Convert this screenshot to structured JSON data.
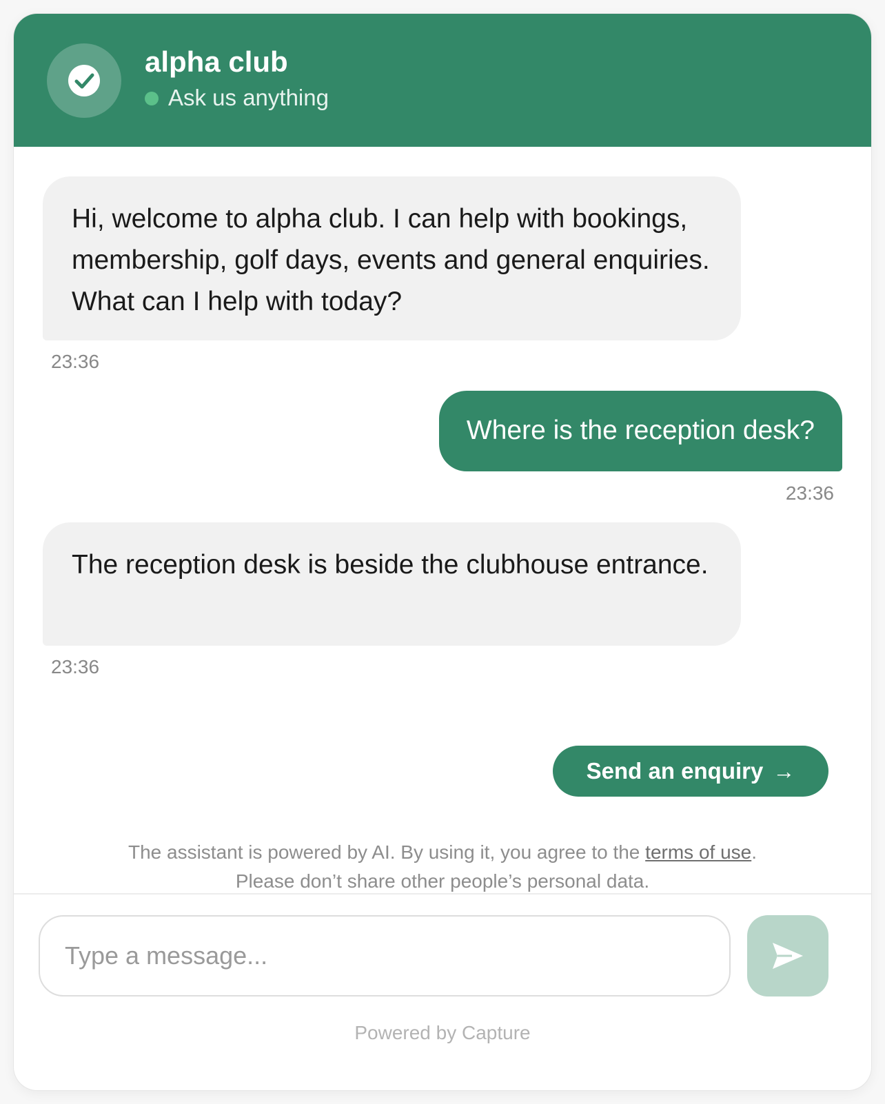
{
  "colors": {
    "brand": "#338868",
    "status_online": "#5cc08a",
    "send_disabled": "#b8d6c9"
  },
  "header": {
    "title": "alpha club",
    "subtitle": "Ask us anything",
    "avatar_icon": "check-icon"
  },
  "messages": [
    {
      "role": "bot",
      "text": "Hi, welcome to alpha club. I can help with bookings, membership, golf days, events and general enquiries. What can I help with today?",
      "time": "23:36"
    },
    {
      "role": "user",
      "text": "Where is the reception desk?",
      "time": "23:36"
    },
    {
      "role": "bot",
      "text": "The reception desk is beside the clubhouse entrance.",
      "time": "23:36"
    }
  ],
  "enquiry_button": {
    "label": "Send an enquiry",
    "arrow": "→"
  },
  "disclaimer": {
    "before_link": "The assistant is powered by AI. By using it, you agree to the ",
    "link_text": "terms of use",
    "after_link": ".",
    "line2": "Please don’t share other people’s personal data."
  },
  "composer": {
    "placeholder": "Type a message...",
    "value": "",
    "send_icon": "send-icon"
  },
  "footer": {
    "powered_by": "Powered by Capture"
  }
}
